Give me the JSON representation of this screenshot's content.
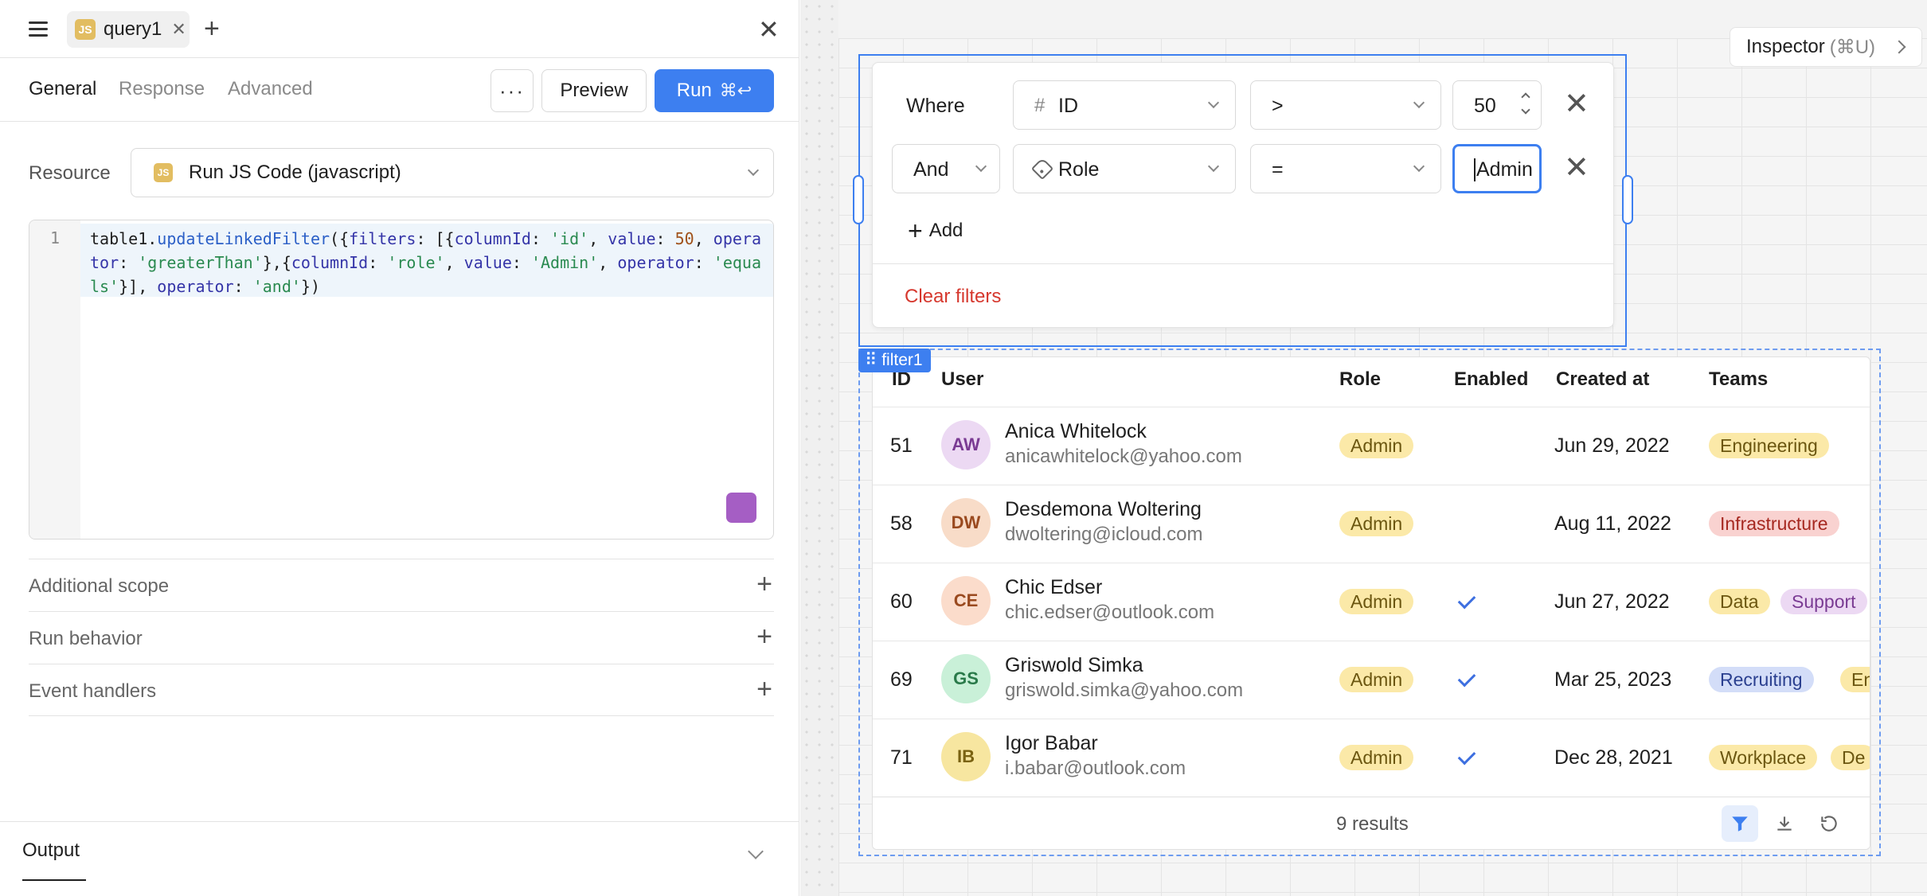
{
  "query_tab": {
    "badge": "JS",
    "label": "query1",
    "close": "✕"
  },
  "add_tab": "+",
  "panel_close": "✕",
  "subtabs": [
    "General",
    "Response",
    "Advanced"
  ],
  "toolbar": {
    "more": "···",
    "preview": "Preview",
    "run": "Run",
    "run_shortcut": "⌘↩"
  },
  "resource": {
    "label": "Resource",
    "badge": "JS",
    "value": "Run JS Code (javascript)"
  },
  "editor": {
    "line_number": "1",
    "code": "table1.updateLinkedFilter({filters: [{columnId: 'id', value: 50, operator: 'greaterThan'},{columnId: 'role', value: 'Admin', operator: 'equals'}], operator: 'and'})"
  },
  "sections": [
    "Additional scope",
    "Run behavior",
    "Event handlers"
  ],
  "output": {
    "label": "Output"
  },
  "inspector": {
    "label": "Inspector",
    "shortcut": "(⌘U)"
  },
  "filter": {
    "rows": [
      {
        "conjunction": "Where",
        "column": "ID",
        "column_icon": "hash-icon",
        "operator": ">",
        "value": "50"
      },
      {
        "conjunction": "And",
        "column": "Role",
        "column_icon": "tag-icon",
        "operator": "=",
        "value": "Admin"
      }
    ],
    "add_label": "Add",
    "clear_label": "Clear filters"
  },
  "table": {
    "component_tag": "filter1",
    "columns": [
      "ID",
      "User",
      "Role",
      "Enabled",
      "Created at",
      "Teams"
    ],
    "rows": [
      {
        "id": "51",
        "initials": "AW",
        "name": "Anica Whitelock",
        "email": "anicawhitelock@yahoo.com",
        "role": "Admin",
        "enabled": false,
        "created": "Jun 29, 2022",
        "teams": [
          "Engineering"
        ],
        "avatar_bg": "#ecd9f3",
        "avatar_fg": "#7a3b93"
      },
      {
        "id": "58",
        "initials": "DW",
        "name": "Desdemona Woltering",
        "email": "dwoltering@icloud.com",
        "role": "Admin",
        "enabled": false,
        "created": "Aug 11, 2022",
        "teams": [
          "Infrastructure"
        ],
        "avatar_bg": "#f8dcc8",
        "avatar_fg": "#9a4a1f"
      },
      {
        "id": "60",
        "initials": "CE",
        "name": "Chic Edser",
        "email": "chic.edser@outlook.com",
        "role": "Admin",
        "enabled": true,
        "created": "Jun 27, 2022",
        "teams": [
          "Data",
          "Support"
        ],
        "avatar_bg": "#fbdccb",
        "avatar_fg": "#9a4a1f"
      },
      {
        "id": "69",
        "initials": "GS",
        "name": "Griswold Simka",
        "email": "griswold.simka@yahoo.com",
        "role": "Admin",
        "enabled": true,
        "created": "Mar 25, 2023",
        "teams": [
          "Recruiting",
          "Eng"
        ],
        "avatar_bg": "#c9f0d8",
        "avatar_fg": "#2a7a4a"
      },
      {
        "id": "71",
        "initials": "IB",
        "name": "Igor Babar",
        "email": "i.babar@outlook.com",
        "role": "Admin",
        "enabled": true,
        "created": "Dec 28, 2021",
        "teams": [
          "Workplace",
          "De"
        ],
        "avatar_bg": "#f7e6a0",
        "avatar_fg": "#7a6212"
      }
    ],
    "results": "9 results"
  },
  "colors": {
    "accent": "#3d7ff0",
    "danger": "#d6382e",
    "role_pill": "#fbe9a8",
    "team_colors": {
      "Engineering": "#fbe9a8",
      "Infrastructure": "#f9d2d0",
      "Data": "#fbe9a8",
      "Support": "#ecd9f3",
      "Recruiting": "#d3ddf8",
      "Eng": "#fbe9a8",
      "Workplace": "#fbe9a8",
      "De": "#fbe9a8"
    }
  }
}
